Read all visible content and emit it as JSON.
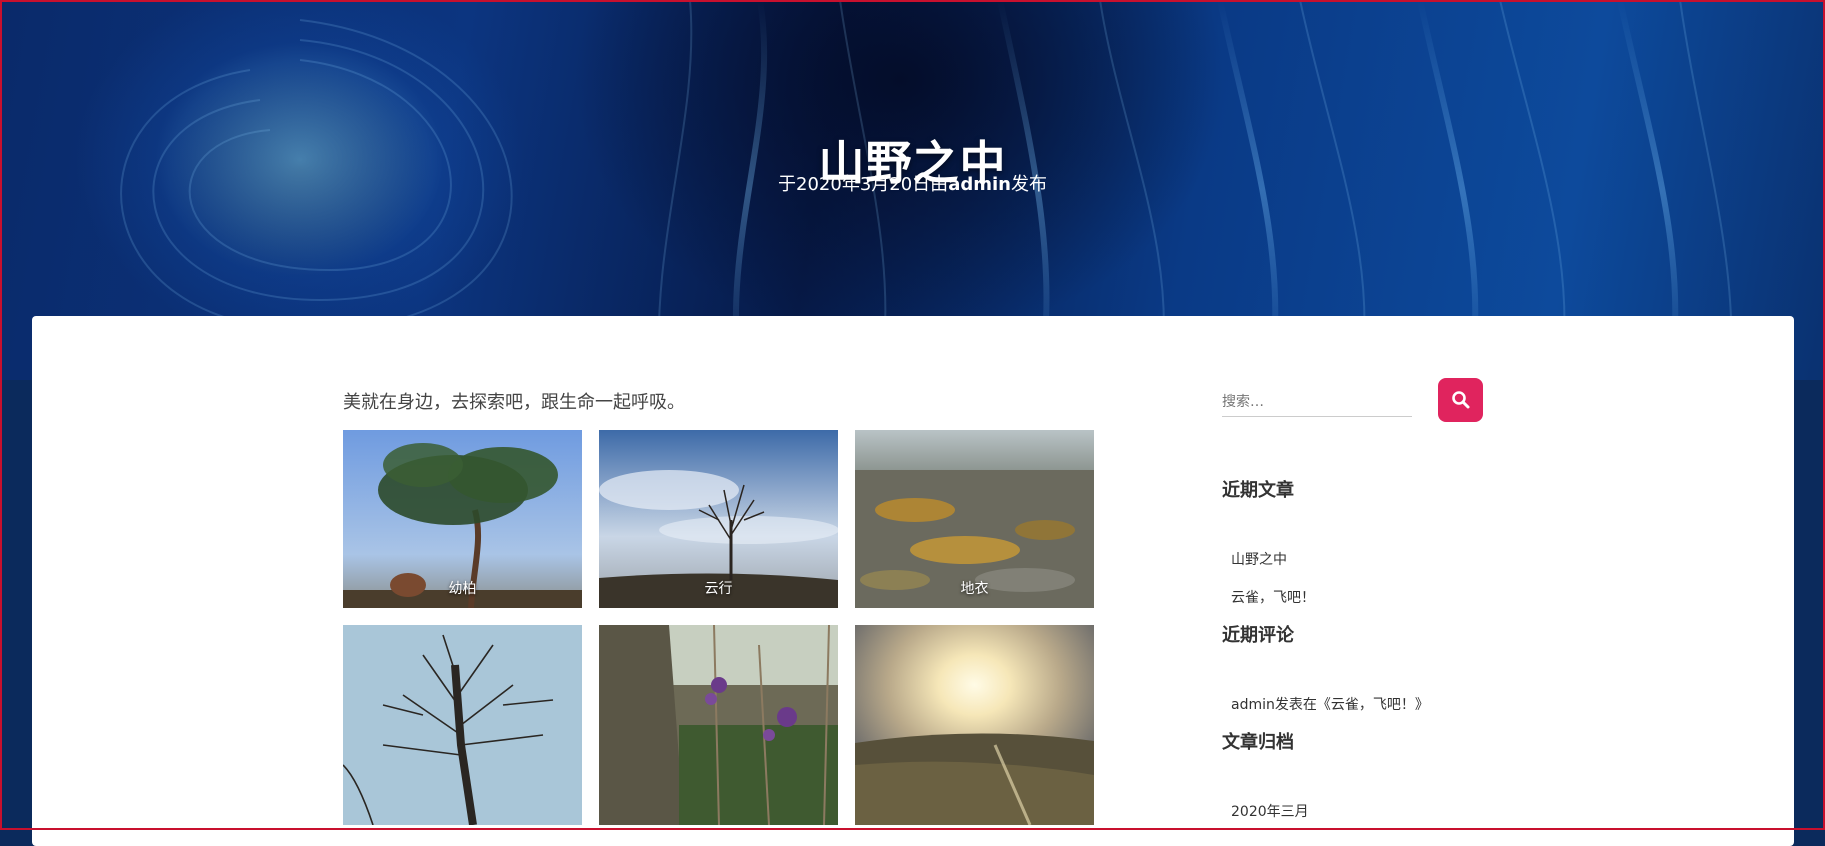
{
  "post": {
    "title": "山野之中",
    "meta_prefix": "于2020年3月20日由",
    "author": "admin",
    "meta_suffix": "发布",
    "intro": "美就在身边，去探索吧，跟生命一起呼吸。"
  },
  "gallery": [
    {
      "caption": "幼柏"
    },
    {
      "caption": "云行"
    },
    {
      "caption": "地衣"
    },
    {
      "caption": ""
    },
    {
      "caption": ""
    },
    {
      "caption": ""
    }
  ],
  "sidebar": {
    "search_placeholder": "搜索…",
    "recent_posts_title": "近期文章",
    "recent_posts": [
      "山野之中",
      "云雀，飞吧！"
    ],
    "recent_comments_title": "近期评论",
    "recent_comment": "admin发表在《云雀，飞吧！》",
    "archives_title": "文章归档",
    "archives": [
      "2020年三月"
    ]
  },
  "colors": {
    "accent": "#e0245e",
    "hero_blue": "#0b2a5c"
  }
}
